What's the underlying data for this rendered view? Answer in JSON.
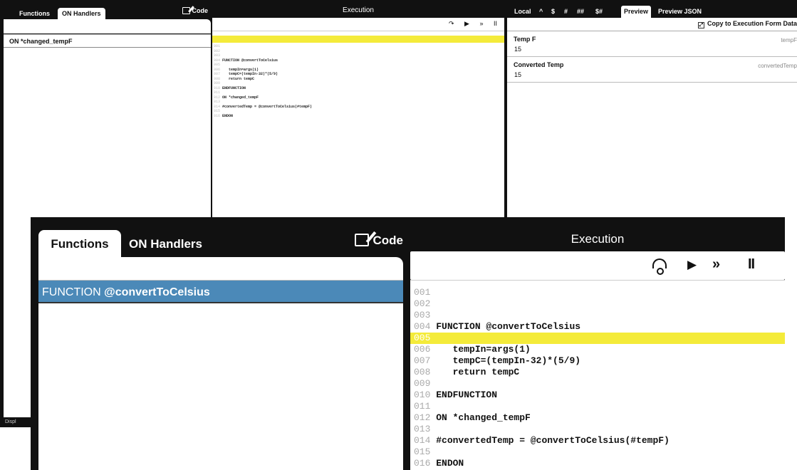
{
  "background": {
    "left_panel": {
      "tabs": [
        "Functions",
        "ON Handlers"
      ],
      "code_label": "Code",
      "handler_item": "ON *changed_tempF",
      "footer_text": "Displ"
    },
    "execution": {
      "title": "Execution",
      "controls": [
        "↷",
        "▶",
        "»",
        "II"
      ],
      "lines": [
        {
          "n": "001",
          "code": ""
        },
        {
          "n": "002",
          "code": ""
        },
        {
          "n": "003",
          "code": ""
        },
        {
          "n": "004",
          "code": "FUNCTION @convertToCelsius"
        },
        {
          "n": "005",
          "code": ""
        },
        {
          "n": "006",
          "code": "   tempIn=args(1)"
        },
        {
          "n": "007",
          "code": "   tempC=(tempIn-32)*(5/9)"
        },
        {
          "n": "008",
          "code": "   return tempC"
        },
        {
          "n": "009",
          "code": ""
        },
        {
          "n": "010",
          "code": "ENDFUNCTION"
        },
        {
          "n": "011",
          "code": ""
        },
        {
          "n": "012",
          "code": "ON *changed_tempF"
        },
        {
          "n": "013",
          "code": ""
        },
        {
          "n": "014",
          "code": "#convertedTemp = @convertToCelsius(#tempF)"
        },
        {
          "n": "015",
          "code": ""
        },
        {
          "n": "016",
          "code": "ENDON"
        }
      ]
    },
    "right_panel": {
      "tabs": [
        "Local",
        "^",
        "$",
        "#",
        "##",
        "$#",
        "Preview",
        "Preview JSON"
      ],
      "copy_label": "Copy to Execution Form Data",
      "fields": [
        {
          "label": "Temp F",
          "value": "15",
          "name": "tempF"
        },
        {
          "label": "Converted Temp",
          "value": "15",
          "name": "convertedTemp"
        }
      ]
    }
  },
  "foreground": {
    "tabs": {
      "functions": "Functions",
      "handlers": "ON Handlers"
    },
    "code_label": "Code",
    "function_item": {
      "keyword": "FUNCTION",
      "name": "@convertToCelsius"
    },
    "execution_title": "Execution",
    "controls": {
      "step": "",
      "run": "▶",
      "run_all": "»",
      "pause": "II"
    },
    "lines": [
      {
        "n": "001",
        "code": ""
      },
      {
        "n": "002",
        "code": ""
      },
      {
        "n": "003",
        "code": ""
      },
      {
        "n": "004",
        "code": "FUNCTION @convertToCelsius"
      },
      {
        "n": "005",
        "code": "",
        "highlight": true
      },
      {
        "n": "006",
        "code": "   tempIn=args(1)"
      },
      {
        "n": "007",
        "code": "   tempC=(tempIn-32)*(5/9)"
      },
      {
        "n": "008",
        "code": "   return tempC"
      },
      {
        "n": "009",
        "code": ""
      },
      {
        "n": "010",
        "code": "ENDFUNCTION"
      },
      {
        "n": "011",
        "code": ""
      },
      {
        "n": "012",
        "code": "ON *changed_tempF"
      },
      {
        "n": "013",
        "code": ""
      },
      {
        "n": "014",
        "code": "#convertedTemp = @convertToCelsius(#tempF)"
      },
      {
        "n": "015",
        "code": ""
      },
      {
        "n": "016",
        "code": "ENDON"
      }
    ],
    "highlight_color": "#f4eb3a",
    "selection_color": "#4b89b8"
  }
}
